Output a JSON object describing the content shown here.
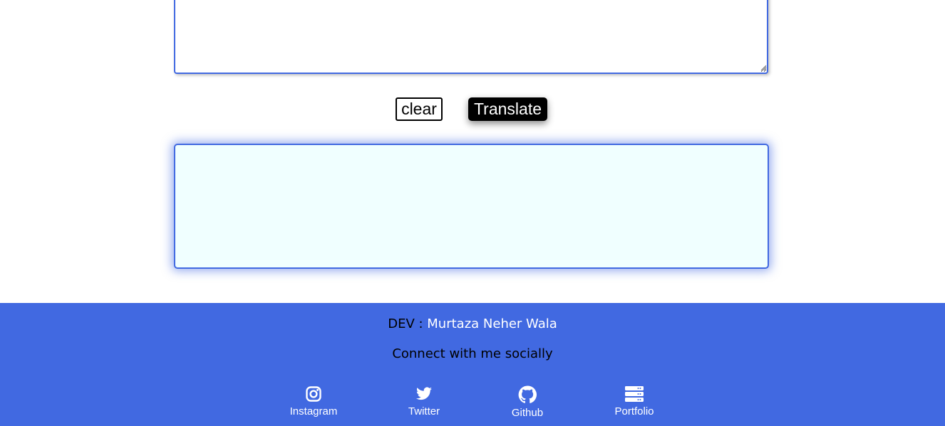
{
  "translate_form": {
    "input_value": "",
    "output_value": "",
    "clear_label": "clear",
    "translate_label": "Translate"
  },
  "footer": {
    "dev_prefix": "DEV : ",
    "dev_name": "Murtaza Neher Wala",
    "connect_text": "Connect with me socially",
    "social_links": [
      {
        "label": "Instagram",
        "icon": "instagram-icon"
      },
      {
        "label": "Twitter",
        "icon": "twitter-icon"
      },
      {
        "label": "Github",
        "icon": "github-icon"
      },
      {
        "label": "Portfolio",
        "icon": "server-icon"
      }
    ]
  },
  "colors": {
    "accent": "#4169e1",
    "output_background": "#f0ffff",
    "button_dark": "#000000",
    "footer_text_highlight": "#ffffff"
  }
}
